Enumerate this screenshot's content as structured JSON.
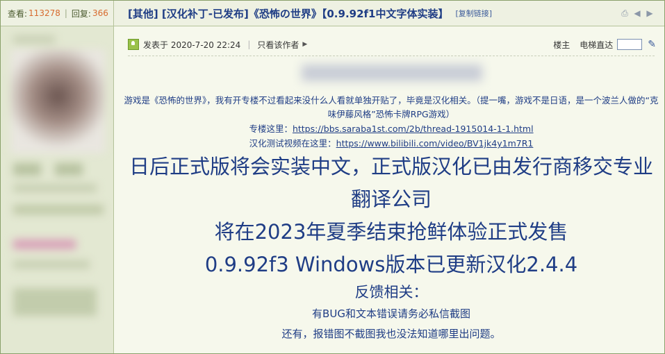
{
  "stats": {
    "views_label": "查看:",
    "views": "113278",
    "replies_label": "回复:",
    "replies": "366"
  },
  "thread": {
    "title": "[其他] [汉化补丁-已发布]《恐怖の世界》【0.9.92f1中文字体实装】",
    "copy_link": "[复制链接]"
  },
  "post": {
    "posted_at": "发表于 2020-7-20 22:24",
    "only_author": "只看该作者",
    "floor": "楼主",
    "elevator": "电梯直达",
    "para1": "游戏是《恐怖的世界》，我有开专楼不过看起来没什么人看就单独开贴了，毕竟是汉化相关。（提一嘴，游戏不是日语，是一个波兰人做的“克味伊藤风格”恐怖卡牌RPG游戏）",
    "thread_label": "专楼这里：",
    "thread_url": "https://bbs.saraba1st.com/2b/thread-1915014-1-1.html",
    "video_label": "汉化测试视频在这里：",
    "video_url": "https://www.bilibili.com/video/BV1jk4y1m7R1",
    "big1": "日后正式版将会实装中文，正式版汉化已由发行商移交专业翻译公司",
    "big2": "将在2023年夏季结束抢鲜体验正式发售",
    "big3": "0.9.92f3 Windows版本已更新汉化2.4.4",
    "feedback": "反馈相关：",
    "line1": "有BUG和文本错误请务必私信截图",
    "line2": "还有，报错图不截图我也没法知道哪里出问题。"
  },
  "colors": {
    "title": "#1f3d85",
    "accent_number": "#d76a2e",
    "border": "#8aa06a"
  }
}
